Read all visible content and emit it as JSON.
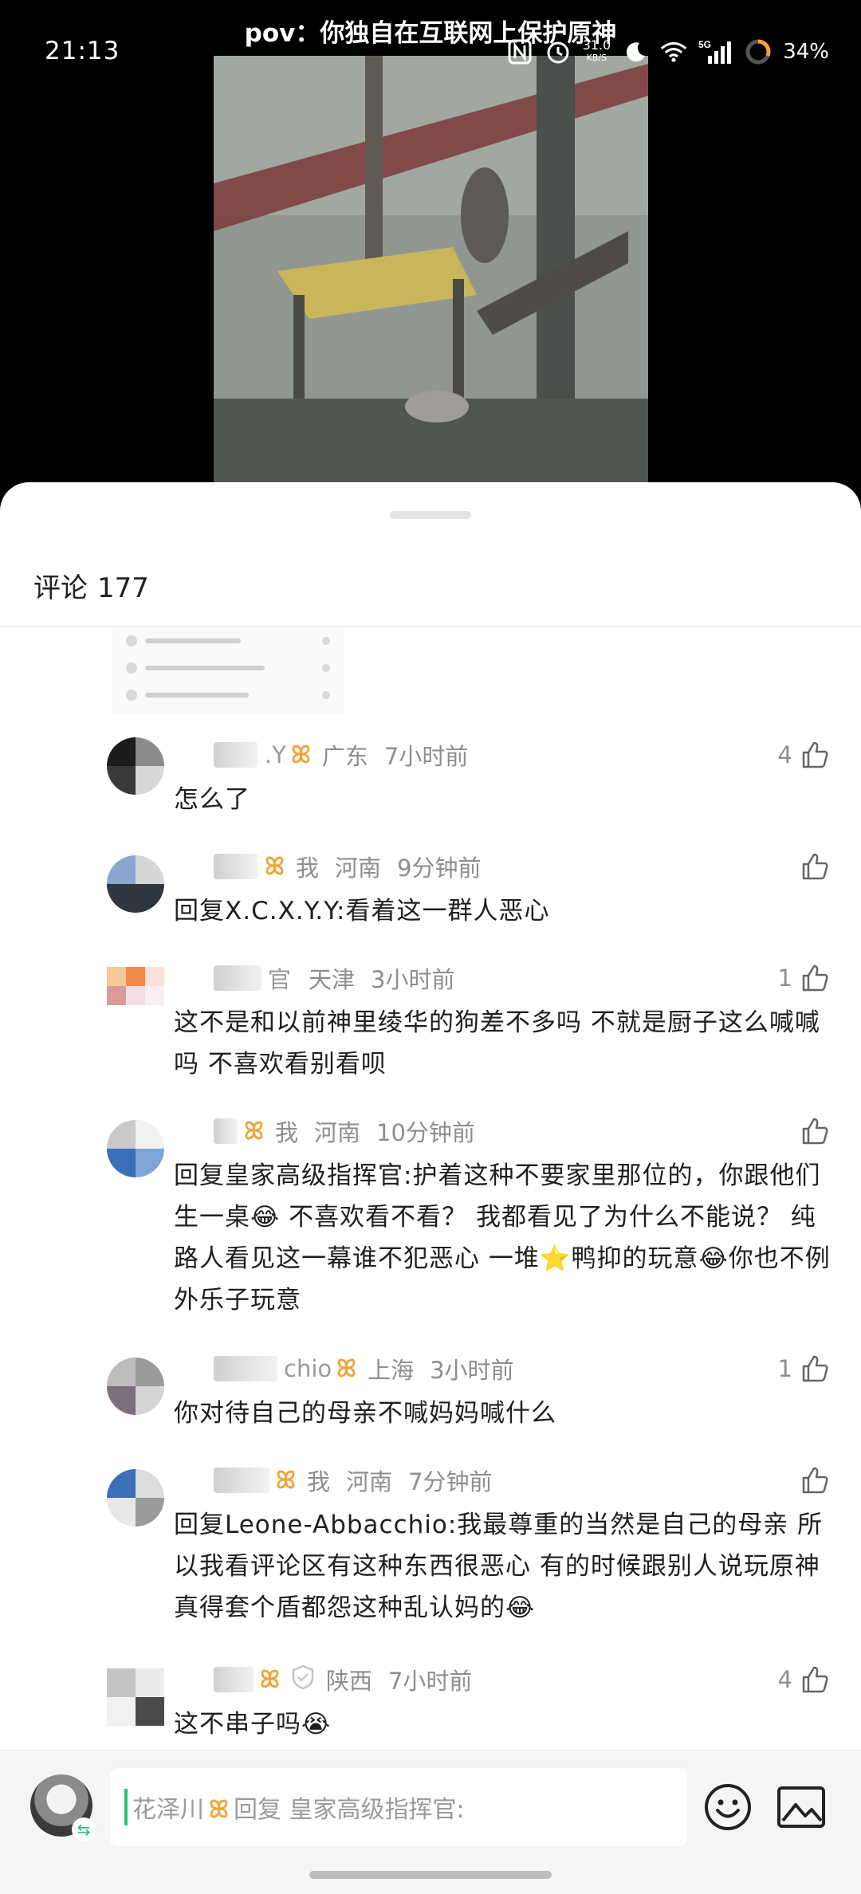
{
  "status_bar": {
    "time": "21:13",
    "net_speed_value": "31.0",
    "net_speed_unit": "KB/S",
    "network": "5G",
    "battery": "34%"
  },
  "video": {
    "title": "pov：你独自在互联网上保护原神"
  },
  "comments_panel": {
    "title": "评论",
    "count": "177",
    "comments": [
      {
        "name_tail": ".Y",
        "badge": "ꕤ",
        "is_me": "",
        "location": "广东",
        "time": "7小时前",
        "likes": "4",
        "text": "怎么了"
      },
      {
        "name_tail": "",
        "badge": "ꕤ",
        "is_me": "我",
        "location": "河南",
        "time": "9分钟前",
        "likes": "",
        "text": "回复X.C.X.Y.Y:看着这一群人恶心"
      },
      {
        "name_tail": "官",
        "badge": "",
        "is_me": "",
        "location": "天津",
        "time": "3小时前",
        "likes": "1",
        "text": "这不是和以前神里绫华的狗差不多吗 不就是厨子这么喊喊吗 不喜欢看别看呗"
      },
      {
        "name_tail": "",
        "badge": "ꕤ",
        "is_me": "我",
        "location": "河南",
        "time": "10分钟前",
        "likes": "",
        "text_parts": [
          "回复皇家高级指挥官:护着这种不要家里那位的，你跟他们生一桌",
          "😂",
          " 不喜欢看不看？ 我都看见了为什么不能说？ 纯路人看见这一幕谁不犯恶心 一堆",
          "⭐",
          "鸭抑的玩意",
          "😂",
          "你也不例外乐子玩意"
        ]
      },
      {
        "name_tail": "chio",
        "badge": "ꕤ",
        "is_me": "",
        "location": "上海",
        "time": "3小时前",
        "likes": "1",
        "text": "你对待自己的母亲不喊妈妈喊什么"
      },
      {
        "name_tail": "",
        "badge": "ꕤ",
        "is_me": "我",
        "location": "河南",
        "time": "7分钟前",
        "likes": "",
        "text_parts": [
          "回复Leone-Abbacchio:我最尊重的当然是自己的母亲 所以我看评论区有这种东西很恶心 有的时候跟别人说玩原神真得套个盾都怨这种乱认妈的",
          "😂"
        ]
      },
      {
        "name_tail": "",
        "badge": "ꕤ",
        "is_me": "",
        "location": "陕西",
        "time": "7小时前",
        "likes": "4",
        "text_parts": [
          "这不串子吗",
          "😭"
        ]
      }
    ]
  },
  "input_bar": {
    "name": "花泽川",
    "badge": "ꕤ",
    "placeholder": "回复 皇家高级指挥官:"
  },
  "colors": {
    "badge": "#f0a43a",
    "accent_green": "#2cbf7a"
  },
  "icons": {
    "like": "thumbs-up-icon",
    "emoji": "emoji-smile-icon",
    "image": "image-icon"
  }
}
